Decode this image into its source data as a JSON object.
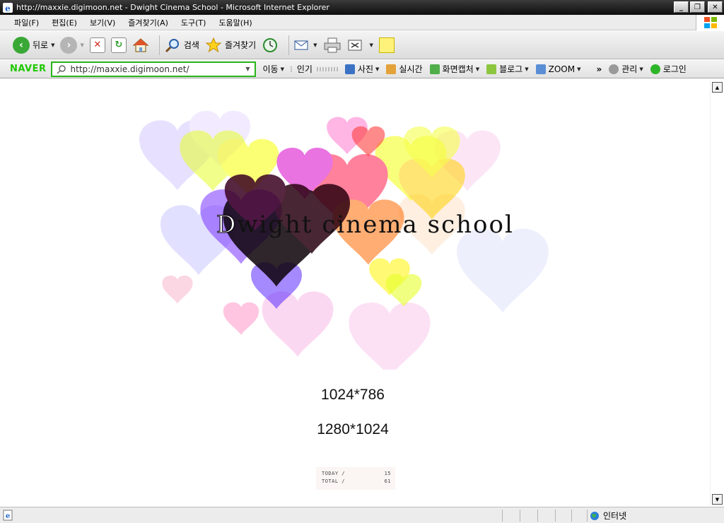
{
  "window": {
    "title": "http://maxxie.digimoon.net - Dwight Cinema School - Microsoft Internet Explorer",
    "minimize_label": "_",
    "restore_label": "❐",
    "close_label": "✕"
  },
  "menu": {
    "items": [
      "파일(F)",
      "편집(E)",
      "보기(V)",
      "즐겨찾기(A)",
      "도구(T)",
      "도움말(H)"
    ]
  },
  "toolbar": {
    "back_label": "뒤로",
    "search_label": "검색",
    "favorites_label": "즐겨찾기"
  },
  "naver": {
    "logo": "NAVER",
    "address": "http://maxxie.digimoon.net/",
    "move_label": "이동",
    "popular_label": "인기",
    "photo_label": "사진",
    "realtime_label": "실시간",
    "capture_label": "화면캡처",
    "blog_label": "블로그",
    "zoom_label": "ZOOM",
    "more_label": "»",
    "manage_label": "관리",
    "login_label": "로그인"
  },
  "page": {
    "site_title_d": "D",
    "site_title_rest": "wight  cinema school",
    "resolution_1": "1024*786",
    "resolution_2": "1280*1024",
    "counter": {
      "today_label": "TODAY /",
      "today_value": "15",
      "total_label": "TOTAL /",
      "total_value": "61"
    }
  },
  "status": {
    "zone_label": "인터넷"
  },
  "colors": {
    "naver_green": "#1ec800",
    "titlebar": "#1a1a1a"
  }
}
